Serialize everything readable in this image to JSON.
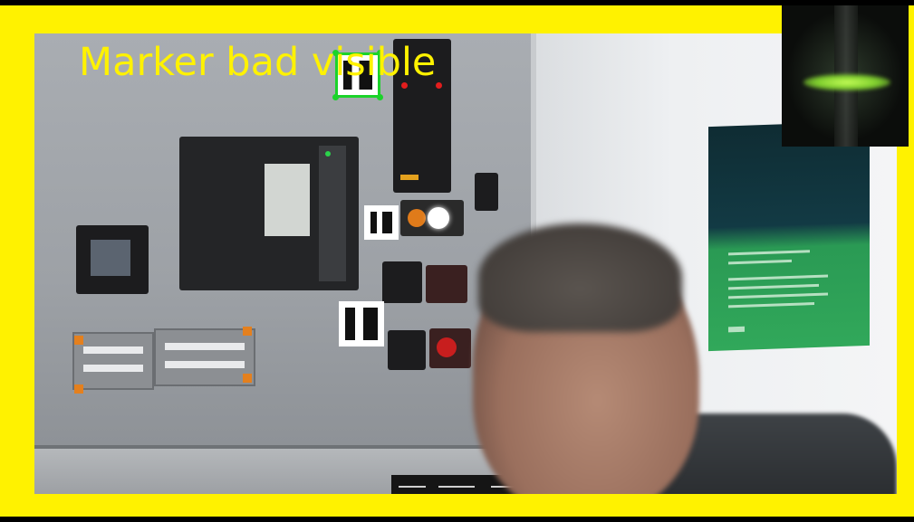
{
  "overlay": {
    "status_text": "Marker bad visible"
  },
  "colors": {
    "frame": "#fff200",
    "overlay_text": "#fff200",
    "detection_box": "#1bd32a",
    "detection_point": "#e11d1d"
  },
  "icons": {
    "detected_marker": "aruco-marker-icon"
  }
}
